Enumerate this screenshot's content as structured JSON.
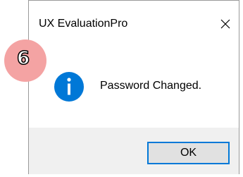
{
  "dialog": {
    "title": "UX EvaluationPro",
    "message": "Password Changed.",
    "ok_label": "OK",
    "icon": "info-icon",
    "close_icon": "close-icon"
  },
  "annotation": {
    "step_number": "6",
    "badge_color": "#f4a3a3"
  },
  "colors": {
    "accent": "#0078d7",
    "footer_bg": "#f0f0f0",
    "button_bg": "#e1e1e1"
  }
}
